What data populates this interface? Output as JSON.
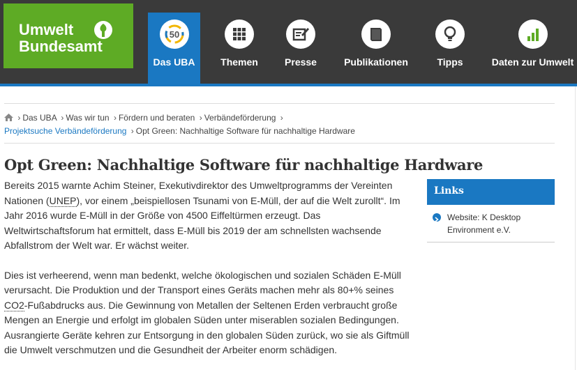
{
  "header": {
    "logo_line1": "Umwelt",
    "logo_line2": "Bundesamt",
    "nav": [
      {
        "label": "Das UBA",
        "icon": "uba-50-icon"
      },
      {
        "label": "Themen",
        "icon": "grid-icon"
      },
      {
        "label": "Presse",
        "icon": "edit-icon"
      },
      {
        "label": "Publikationen",
        "icon": "book-icon"
      },
      {
        "label": "Tipps",
        "icon": "lightbulb-icon"
      },
      {
        "label": "Daten zur Umwelt",
        "icon": "bar-chart-icon"
      }
    ],
    "uba_badge": "50"
  },
  "breadcrumb": {
    "items": [
      "Das UBA",
      "Was wir tun",
      "Fördern und beraten",
      "Verbändeförderung"
    ],
    "link": "Projektsuche Verbändeförderung",
    "current": "Opt Green: Nachhaltige Software für nachhaltige Hardware"
  },
  "page": {
    "title": "Opt Green: Nachhaltige Software für nachhaltige Hardware",
    "p1_a": "Bereits 2015 warnte Achim Steiner, Exekutivdirektor des Umweltprogramms der Vereinten Nationen (",
    "p1_abbr": "UNEP",
    "p1_b": "), vor einem „beispiellosen Tsunami von E-Müll, der auf die Welt zurollt“. Im Jahr 2016 wurde E-Müll in der Größe von 4500 Eiffeltürmen erzeugt. Das Weltwirtschaftsforum hat ermittelt, dass E-Müll bis 2019 der am schnellsten wachsende Abfallstrom der Welt war. Er wächst weiter.",
    "p2_a": "Dies ist verheerend, wenn man bedenkt, welche ökologischen und sozialen Schäden E-Müll verursacht. Die Produktion und der Transport eines Geräts machen mehr als 80+% seines ",
    "p2_abbr": "CO2",
    "p2_b": "-Fußabdrucks aus. Die Gewinnung von Metallen der Seltenen Erden verbraucht große Mengen an Energie und erfolgt im globalen Süden unter miserablen sozialen Bedingungen. Ausrangierte Geräte kehren zur Entsorgung in den globalen Süden zurück, wo sie als Giftmüll die Umwelt verschmutzen und die Gesundheit der Arbeiter enorm schädigen."
  },
  "sidebar": {
    "title": "Links",
    "link_text": "Website: K Desktop Environment e.V."
  },
  "colors": {
    "brand_green": "#5eab25",
    "brand_blue": "#1a78c2",
    "header_dark": "#3a3a3a"
  }
}
